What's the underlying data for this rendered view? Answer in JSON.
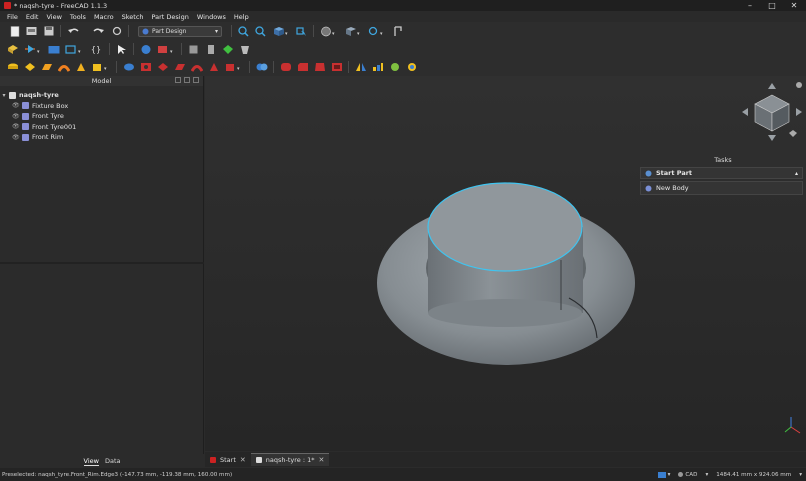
{
  "window": {
    "title": "* naqsh-tyre - FreeCAD 1.1.3"
  },
  "window_controls": [
    "–",
    "□",
    "✕"
  ],
  "menu": [
    "File",
    "Edit",
    "View",
    "Tools",
    "Macro",
    "Sketch",
    "Part Design",
    "Windows",
    "Help"
  ],
  "workbench": {
    "selected": "Part Design"
  },
  "model_panel": {
    "title": "Model",
    "document": "naqsh-tyre",
    "items": [
      {
        "label": "Fixture Box",
        "icon_color": "#8a8fd6"
      },
      {
        "label": "Front Tyre",
        "icon_color": "#8a8fd6"
      },
      {
        "label": "Front Tyre001",
        "icon_color": "#8a8fd6"
      },
      {
        "label": "Front Rim",
        "icon_color": "#8a8fd6"
      }
    ],
    "tabs": [
      "View",
      "Data"
    ],
    "active_tab": "View"
  },
  "tasks": {
    "title": "Tasks",
    "start_part": "Start Part",
    "new_body": "New Body"
  },
  "doc_tabs": [
    {
      "label": "Start",
      "active": false
    },
    {
      "label": "naqsh-tyre : 1*",
      "active": true
    }
  ],
  "status": {
    "preselection": "Preselected: naqsh_tyre.Front_Rim.Edge3 (-147.73 mm, -119.38 mm, 160.00 mm)",
    "nav_style": "CAD",
    "dimensions": "1484.41 mm x 924.06 mm"
  },
  "colors": {
    "accent_edge": "#3fc4f0",
    "model_gray": "#8e959a",
    "background": "#2b2b2b"
  }
}
